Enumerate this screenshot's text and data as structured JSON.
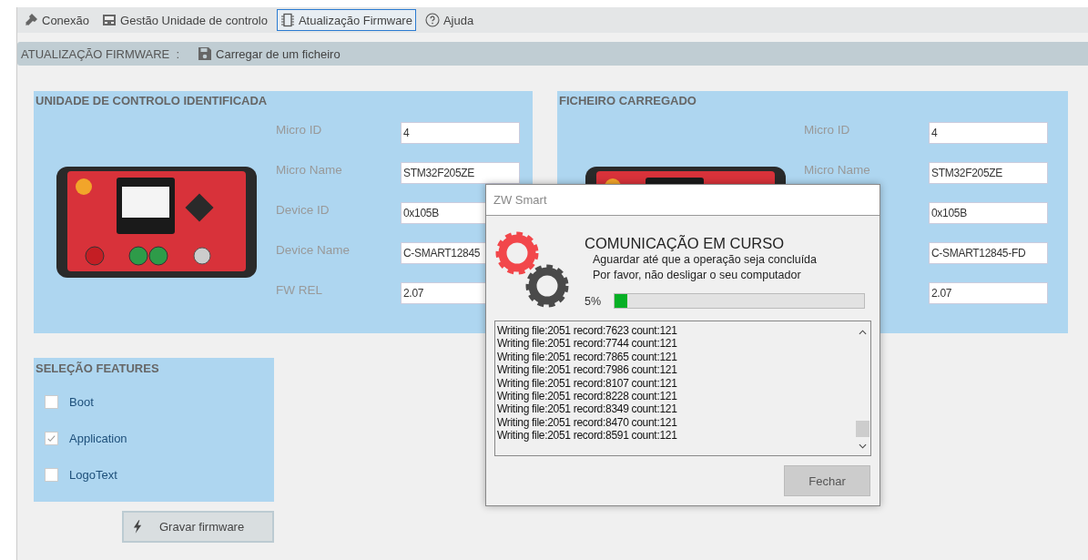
{
  "menu": [
    {
      "label": "Conexão",
      "kind": "plug",
      "selected": false
    },
    {
      "label": "Gestão Unidade de controlo",
      "kind": "device",
      "selected": false
    },
    {
      "label": "Atualização Firmware",
      "kind": "chip",
      "selected": true
    },
    {
      "label": "Ajuda",
      "kind": "help",
      "selected": false
    }
  ],
  "subbar": {
    "title": "ATUALIZAÇÃO FIRMWARE  :",
    "action": "Carregar de um ficheiro"
  },
  "panels": [
    {
      "title": "UNIDADE DE CONTROLO IDENTIFICADA",
      "fields": [
        {
          "label": "Micro ID",
          "value": "4"
        },
        {
          "label": "Micro Name",
          "value": "STM32F205ZE"
        },
        {
          "label": "Device ID",
          "value": "0x105B"
        },
        {
          "label": "Device Name",
          "value": "C-SMART12845"
        },
        {
          "label": "FW REL",
          "value": "2.07"
        }
      ]
    },
    {
      "title": "FICHEIRO CARREGADO",
      "fields": [
        {
          "label": "Micro ID",
          "value": "4"
        },
        {
          "label": "Micro Name",
          "value": "STM32F205ZE"
        },
        {
          "value": "0x105B"
        },
        {
          "value": "C-SMART12845-FD"
        },
        {
          "value": "2.07"
        }
      ]
    }
  ],
  "features": {
    "title": "SELEÇÃO FEATURES",
    "items": [
      {
        "label": "Boot",
        "checked": false
      },
      {
        "label": "Application",
        "checked": true
      },
      {
        "label": "LogoText",
        "checked": false
      }
    ]
  },
  "burn_button": "Gravar firmware",
  "dialog": {
    "title": "ZW Smart",
    "heading": "COMUNICAÇÃO EM CURSO",
    "lines": [
      "Aguardar até que a operação seja concluída",
      "Por favor, não desligar o seu computador"
    ],
    "progress": {
      "reading": "5%",
      "level": 0.05
    },
    "log": [
      "Writing file:2051 record:7623 count:121",
      "Writing file:2051 record:7744 count:121",
      "Writing file:2051 record:7865 count:121",
      "Writing file:2051 record:7986 count:121",
      "Writing file:2051 record:8107 count:121",
      "Writing file:2051 record:8228 count:121",
      "Writing file:2051 record:8349 count:121",
      "Writing file:2051 record:8470 count:121",
      "Writing file:2051 record:8591 count:121"
    ],
    "button": "Fechar"
  }
}
